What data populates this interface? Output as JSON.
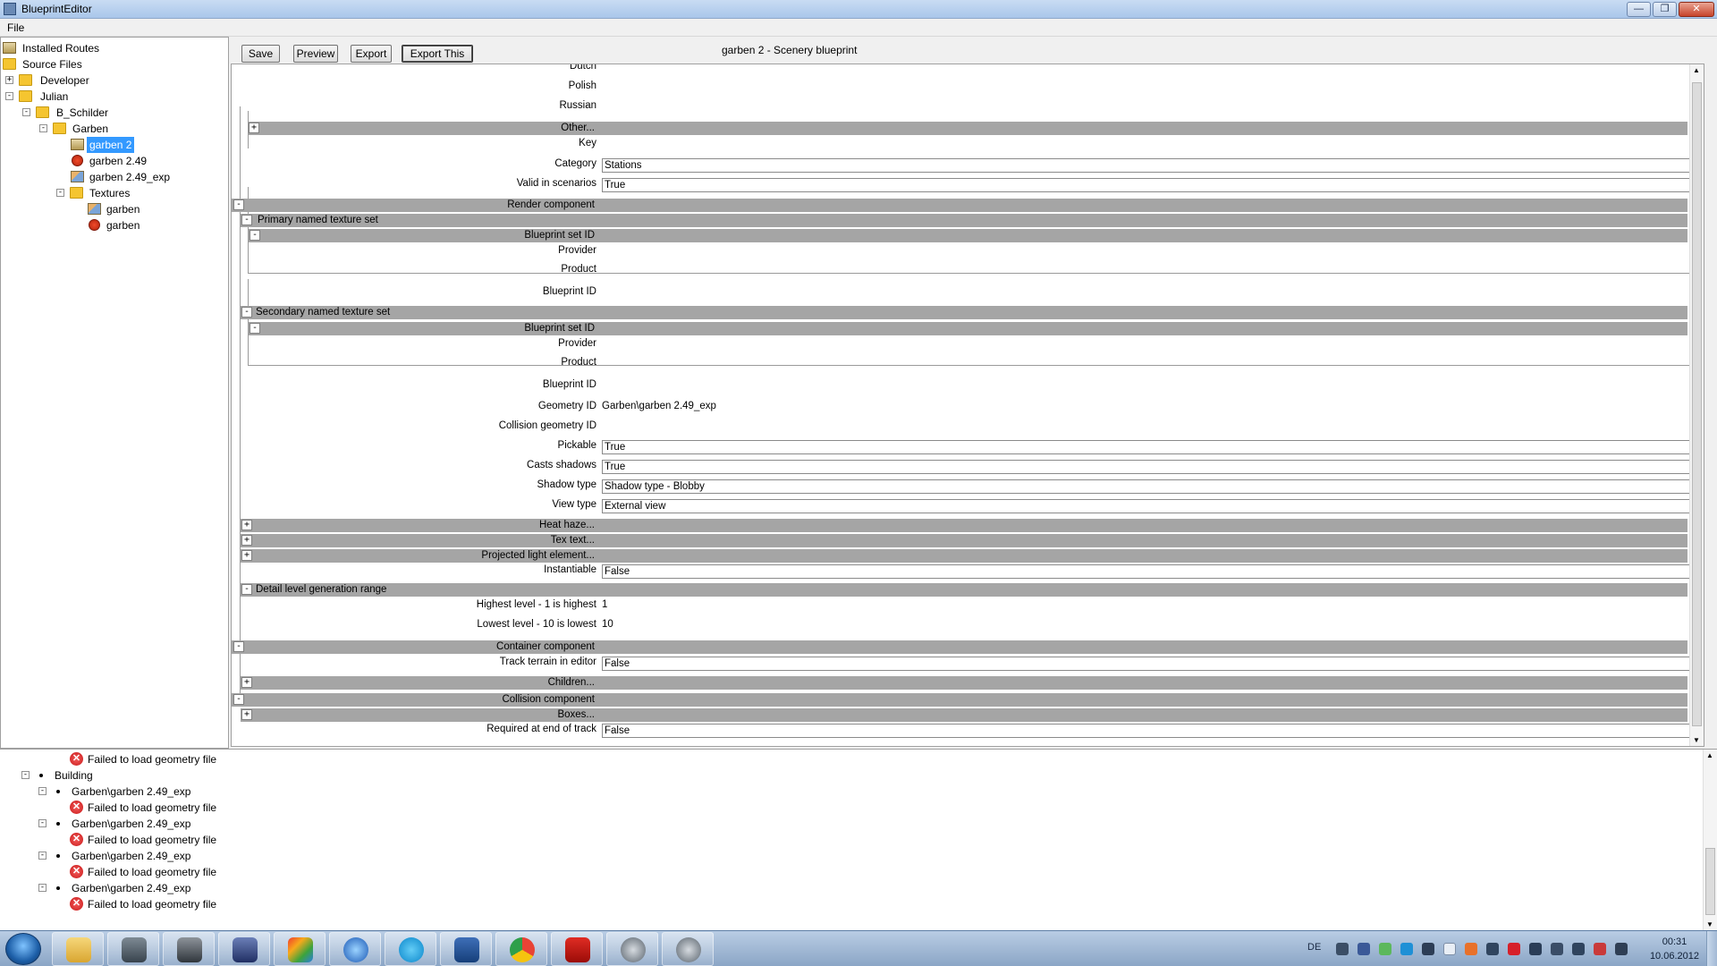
{
  "window": {
    "title": "BlueprintEditor",
    "min_label": "—",
    "max_label": "❐",
    "close_label": "✕"
  },
  "menu": {
    "file": "File"
  },
  "tree": {
    "items": [
      {
        "label": "Installed Routes",
        "icon": "routes-icon"
      },
      {
        "label": "Source Files",
        "icon": "folder-icon"
      },
      {
        "label": "Developer",
        "icon": "folder-icon",
        "toggle": "+"
      },
      {
        "label": "Julian",
        "icon": "folder-icon",
        "toggle": "-"
      },
      {
        "label": "B_Schilder",
        "icon": "folder-icon",
        "toggle": "-"
      },
      {
        "label": "Garben",
        "icon": "folder-icon",
        "toggle": "-"
      },
      {
        "label": "garben 2",
        "icon": "blueprint-icon",
        "selected": true
      },
      {
        "label": "garben 2.49",
        "icon": "error-file-icon"
      },
      {
        "label": "garben 2.49_exp",
        "icon": "geometry-icon"
      },
      {
        "label": "Textures",
        "icon": "folder-icon",
        "toggle": "-"
      },
      {
        "label": "garben",
        "icon": "image-icon"
      },
      {
        "label": "garben",
        "icon": "error-file-icon"
      }
    ]
  },
  "toolbar": {
    "save": "Save",
    "preview": "Preview",
    "export": "Export",
    "export_this": "Export This",
    "doc_title": "garben 2 - Scenery blueprint"
  },
  "props": {
    "dutch": "Dutch",
    "polish": "Polish",
    "russian": "Russian",
    "other": "Other...",
    "key": "Key",
    "category": {
      "label": "Category",
      "value": "Stations"
    },
    "valid_in_scenarios": {
      "label": "Valid in scenarios",
      "value": "True"
    },
    "render_component": "Render component",
    "primary_texture_set": "Primary named texture set",
    "blueprint_set_id": "Blueprint set ID",
    "provider": "Provider",
    "product": "Product",
    "blueprint_id": "Blueprint ID",
    "secondary_texture_set": "Secondary named texture set",
    "geometry_id": {
      "label": "Geometry ID",
      "value": "Garben\\garben 2.49_exp"
    },
    "collision_geometry_id": {
      "label": "Collision geometry ID",
      "value": ""
    },
    "pickable": {
      "label": "Pickable",
      "value": "True"
    },
    "casts_shadows": {
      "label": "Casts shadows",
      "value": "True"
    },
    "shadow_type": {
      "label": "Shadow type",
      "value": "Shadow type - Blobby"
    },
    "view_type": {
      "label": "View type",
      "value": "External view"
    },
    "heat_haze": "Heat haze...",
    "tex_text": "Tex text...",
    "projected_light": "Projected light element...",
    "instantiable": {
      "label": "Instantiable",
      "value": "False"
    },
    "detail_level_range": "Detail level generation range",
    "highest_level": {
      "label": "Highest level - 1 is highest",
      "value": "1"
    },
    "lowest_level": {
      "label": "Lowest level - 10 is lowest",
      "value": "10"
    },
    "container_component": "Container component",
    "track_terrain": {
      "label": "Track terrain in editor",
      "value": "False"
    },
    "children": "Children...",
    "collision_component": "Collision component",
    "boxes": "Boxes...",
    "required_end_track": {
      "label": "Required at end of track",
      "value": "False"
    }
  },
  "log": {
    "failed": "Failed to load geometry file",
    "building": "Building",
    "geometry_ref": "Garben\\garben 2.49_exp"
  },
  "taskbar": {
    "apps": [
      "explorer",
      "totalcmd",
      "worldoftanks",
      "railworks",
      "windows-live",
      "itunes",
      "skype",
      "stocks",
      "chrome",
      "acrobat",
      "program-1",
      "program-2"
    ],
    "lang": "DE",
    "time": "00:31",
    "date": "10.06.2012"
  }
}
